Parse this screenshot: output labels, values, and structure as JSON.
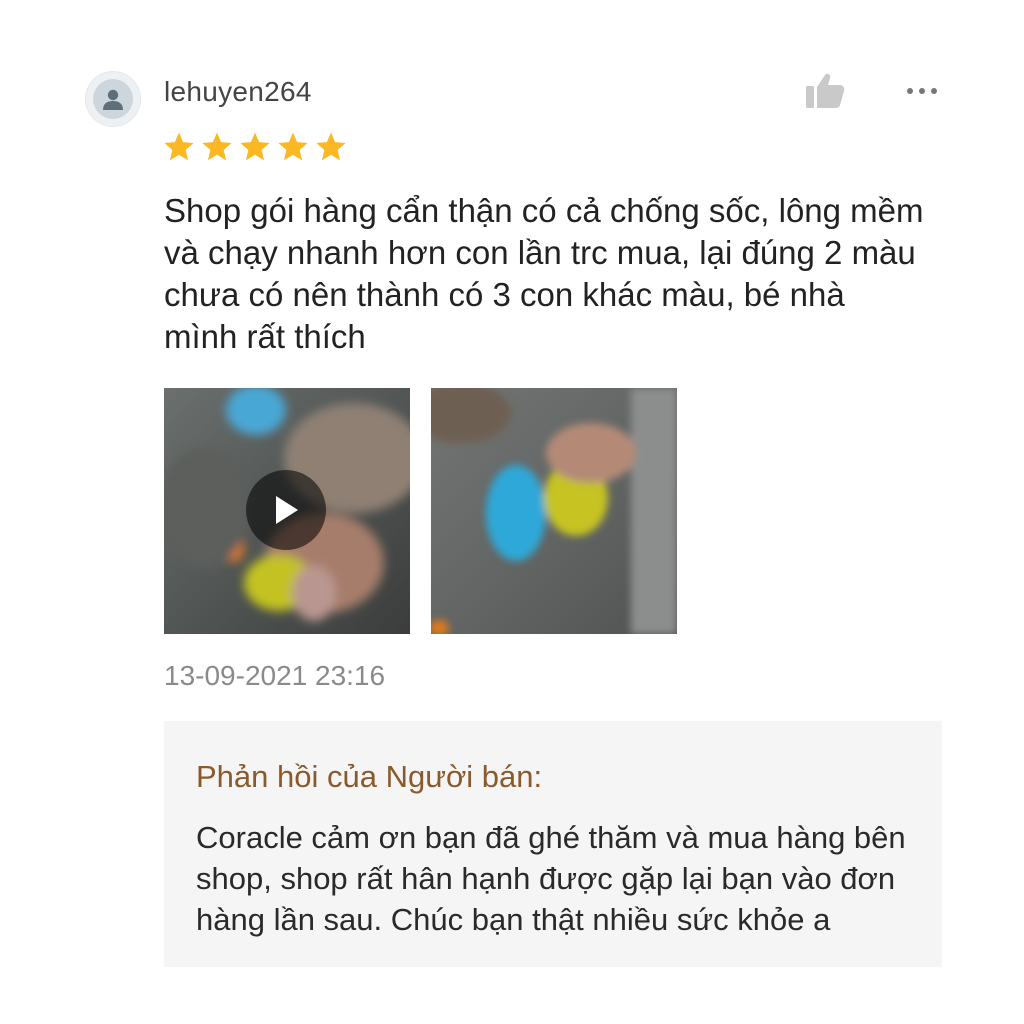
{
  "review": {
    "username": "lehuyen264",
    "rating": 5,
    "text": "Shop gói hàng cẩn thận có cả chống sốc, lông mềm và chạy nhanh hơn con lần trc mua, lại đúng 2 màu chưa có nên thành có 3 con khác màu, bé nhà mình rất thích",
    "timestamp": "13-09-2021 23:16",
    "media": [
      {
        "type": "video",
        "icon": "play-icon"
      },
      {
        "type": "image"
      }
    ]
  },
  "actions": {
    "like_icon": "thumbs-up-icon",
    "more_icon": "more-icon"
  },
  "seller_reply": {
    "title": "Phản hồi của Người bán:",
    "text": "Coracle cảm ơn bạn đã ghé thăm và mua hàng bên shop, shop rất hân hạnh được gặp lại bạn vào đơn hàng lần sau. Chúc bạn thật nhiều sức khỏe a"
  },
  "colors": {
    "star": "#fbb825",
    "reply_title": "#8a5a2b",
    "reply_bg": "#f5f5f5",
    "timestamp": "#8a8a8a"
  }
}
